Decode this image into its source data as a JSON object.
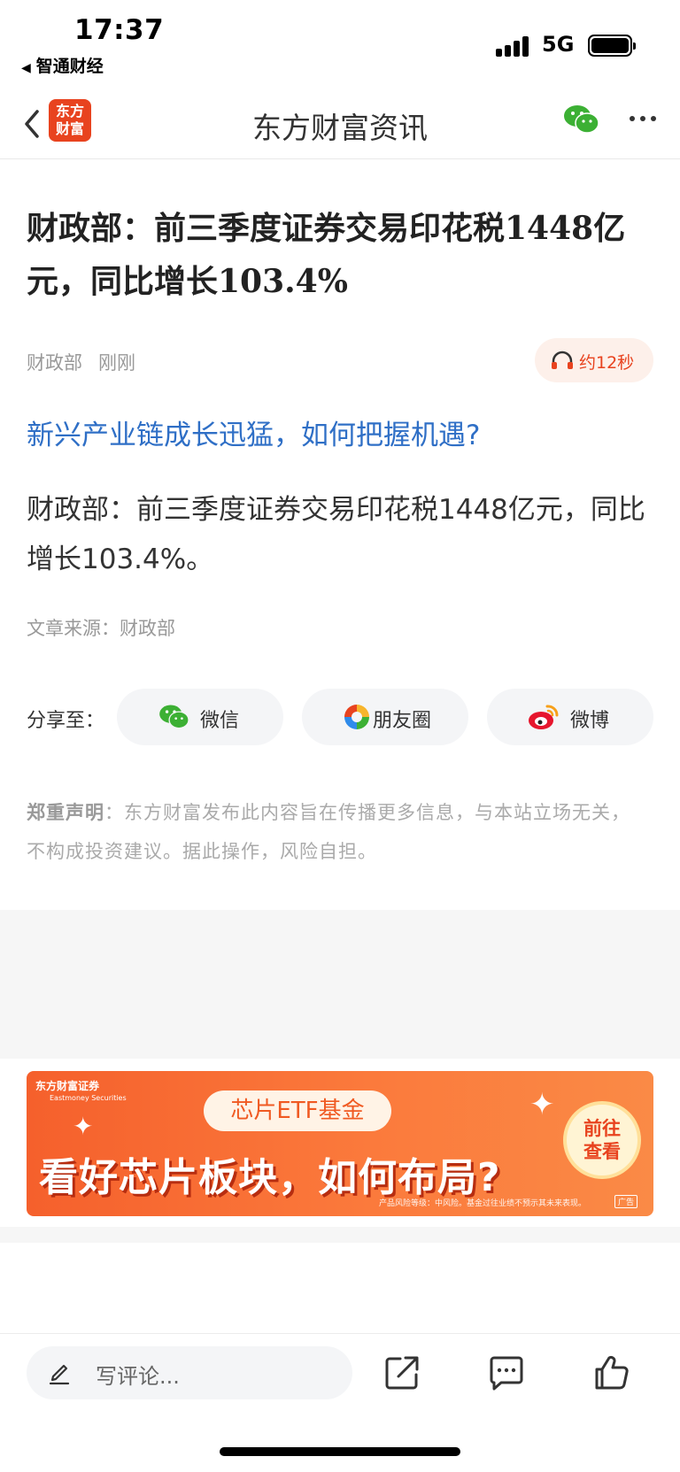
{
  "status_bar": {
    "time": "17:37",
    "back_app": "智通财经",
    "network": "5G"
  },
  "navbar": {
    "logo_text_line1": "东方",
    "logo_text_line2": "财富",
    "title": "东方财富资讯"
  },
  "article": {
    "headline": "财政部：前三季度证券交易印花税1448亿元，同比增长103.4%",
    "author": "财政部",
    "time": "刚刚",
    "audio_label": "约12秒",
    "promo_link": "新兴产业链成长迅猛，如何把握机遇?",
    "body": "财政部：前三季度证券交易印花税1448亿元，同比增长103.4%。",
    "source": "文章来源：财政部"
  },
  "share": {
    "label": "分享至：",
    "wechat": "微信",
    "moments": "朋友圈",
    "weibo": "微博"
  },
  "disclaimer": {
    "title": "郑重声明",
    "text": "：东方财富发布此内容旨在传播更多信息，与本站立场无关，不构成投资建议。据此操作，风险自担。"
  },
  "ad": {
    "brand": "东方财富证券",
    "brand_en": "Eastmoney Securities",
    "pill": "芯片ETF基金",
    "headline": "看好芯片板块，如何布局?",
    "cta_line1": "前往",
    "cta_line2": "查看",
    "footnote": "产品风险等级：中风险。基金过往业绩不预示其未来表现。",
    "tag": "广告"
  },
  "bottom_bar": {
    "comment_placeholder": "写评论..."
  }
}
